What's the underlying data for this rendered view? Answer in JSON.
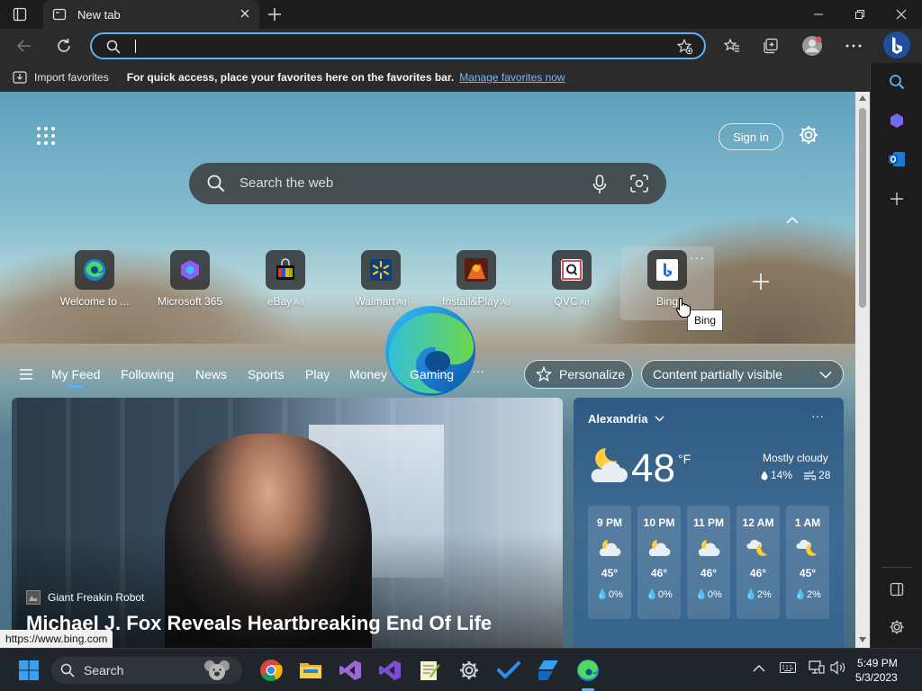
{
  "browser": {
    "tab_title": "New tab",
    "address_value": "",
    "favorites_import": "Import favorites",
    "favorites_hint": "For quick access, place your favorites here on the favorites bar.",
    "favorites_manage": "Manage favorites now",
    "status_url": "https://www.bing.com"
  },
  "newtab": {
    "sign_in": "Sign in",
    "search_placeholder": "Search the web",
    "quick_links": [
      {
        "label": "Welcome to ...",
        "ad": ""
      },
      {
        "label": "Microsoft 365",
        "ad": ""
      },
      {
        "label": "eBay",
        "ad": "Ad"
      },
      {
        "label": "Walmart",
        "ad": "Ad"
      },
      {
        "label": "Install&Play",
        "ad": "Ad"
      },
      {
        "label": "QVC",
        "ad": "Ad"
      },
      {
        "label": "Bing",
        "ad": ""
      }
    ],
    "tooltip": "Bing",
    "feed_tabs": [
      "My Feed",
      "Following",
      "News",
      "Sports",
      "Play",
      "Money",
      "Gaming"
    ],
    "personalize": "Personalize",
    "layout_select": "Content partially visible"
  },
  "hero": {
    "source": "Giant Freakin Robot",
    "title": "Michael J. Fox Reveals Heartbreaking End Of Life"
  },
  "weather": {
    "location": "Alexandria",
    "temp": "48",
    "unit": "°F",
    "condition": "Mostly cloudy",
    "precip": "14%",
    "wind": "28",
    "hourly": [
      {
        "time": "9 PM",
        "temp": "45°",
        "precip": "0%",
        "icon": "partly-cloudy-night"
      },
      {
        "time": "10 PM",
        "temp": "46°",
        "precip": "0%",
        "icon": "partly-cloudy-night"
      },
      {
        "time": "11 PM",
        "temp": "46°",
        "precip": "0%",
        "icon": "partly-cloudy-night"
      },
      {
        "time": "12 AM",
        "temp": "46°",
        "precip": "2%",
        "icon": "cloudy-moon"
      },
      {
        "time": "1 AM",
        "temp": "45°",
        "precip": "2%",
        "icon": "cloudy-moon"
      }
    ]
  },
  "taskbar": {
    "search_label": "Search",
    "time": "5:49 PM",
    "date": "5/3/2023"
  },
  "colors": {
    "accent": "#5fb2f2",
    "chrome_dark": "#1c1c1c",
    "toolbar": "#2b2b2b",
    "link": "#7db4f5"
  }
}
